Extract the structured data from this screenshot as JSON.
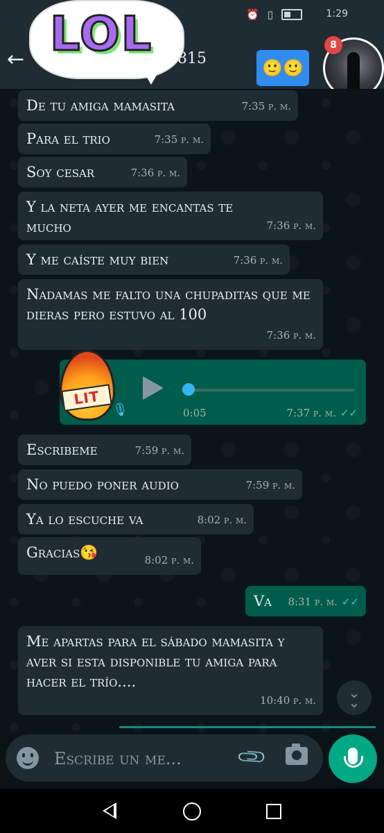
{
  "status_bar": {
    "time": "1:29",
    "icons": [
      "alarm-icon",
      "vibrate-icon",
      "battery-icon"
    ]
  },
  "header": {
    "back_icon": "arrow-left-icon",
    "contact_number_fragment": "815",
    "sticker_lol": "LOL",
    "sticker_emojis": "🙂🙂",
    "notification_count": "8"
  },
  "messages": [
    {
      "text": "De tu amiga mamasita",
      "time": "7:35 p. m.",
      "direction": "in"
    },
    {
      "text": "Para el trio",
      "time": "7:35 p. m.",
      "direction": "in"
    },
    {
      "text": "Soy cesar",
      "time": "7:36 p. m.",
      "direction": "in"
    },
    {
      "text": "Y la neta ayer me encantas te mucho",
      "time": "7:36 p. m.",
      "direction": "in"
    },
    {
      "text": "Y me caíste muy bien",
      "time": "7:36 p. m.",
      "direction": "in"
    },
    {
      "text": "Nadamas me falto una chupaditas que me dieras  pero estuvo al 100",
      "time": "7:36 p. m.",
      "direction": "in"
    },
    {
      "text": "Escribeme",
      "time": "7:59 p. m.",
      "direction": "in"
    },
    {
      "text": "No puedo poner audio",
      "time": "7:59 p. m.",
      "direction": "in"
    },
    {
      "text": "Ya lo escuche va",
      "time": "8:02 p. m.",
      "direction": "in"
    },
    {
      "text": "Gracias😘",
      "time": "8:02 p. m.",
      "direction": "in"
    },
    {
      "text": "Va",
      "time": "8:31 p. m.",
      "direction": "out"
    },
    {
      "text": "Me apartas para el sábado mamasita y aver si esta disponible tu amiga para hacer el trío....",
      "time": "10:40 p. m.",
      "direction": "in"
    }
  ],
  "audio_message": {
    "duration": "0:05",
    "time": "7:37 p. m.",
    "progress": 0,
    "sticker_lit": "LIT",
    "direction": "out"
  },
  "input_bar": {
    "placeholder": "Escribe un me...",
    "emoji_icon": "emoji-icon",
    "attach_icon": "paperclip-icon",
    "camera_icon": "camera-icon",
    "mic_icon": "mic-icon"
  },
  "scroll_down_icon": "double-chevron-down-icon",
  "nav_bar": {
    "icons": [
      "nav-back-icon",
      "nav-home-icon",
      "nav-recent-icon"
    ]
  },
  "colors": {
    "chat_bg": "#0b141a",
    "incoming_bubble": "#1f2c34",
    "outgoing_bubble": "#005c4b",
    "accent": "#00a884",
    "read_ticks": "#53bdeb"
  }
}
